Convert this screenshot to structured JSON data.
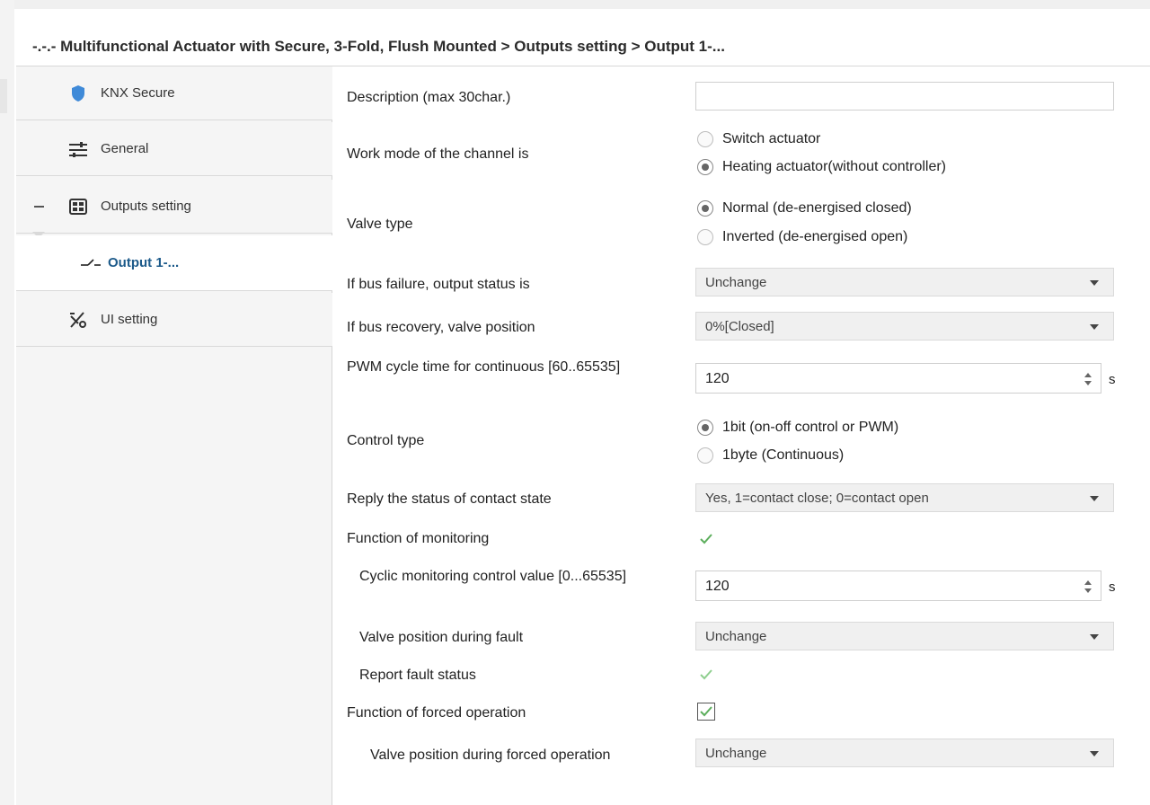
{
  "header": {
    "title": "-.-.- Multifunctional Actuator with Secure, 3-Fold, Flush Mounted > Outputs setting > Output 1-..."
  },
  "sidebar": {
    "items": [
      {
        "label": "KNX Secure",
        "icon": "shield-icon"
      },
      {
        "label": "General",
        "icon": "sliders-icon"
      },
      {
        "label": "Outputs setting",
        "icon": "grid-panel-icon"
      },
      {
        "label": "Output 1-...",
        "icon": "switch-contact-icon"
      },
      {
        "label": "UI setting",
        "icon": "ui-tools-icon"
      }
    ]
  },
  "form": {
    "description": {
      "label": "Description (max 30char.)",
      "value": ""
    },
    "work_mode": {
      "label": "Work mode of the channel is",
      "options": [
        "Switch actuator",
        "Heating actuator(without controller)"
      ],
      "selected": 1
    },
    "valve_type": {
      "label": "Valve type",
      "options": [
        "Normal (de-energised closed)",
        "Inverted (de-energised open)"
      ],
      "selected": 0
    },
    "bus_failure": {
      "label": "If bus failure, output status is",
      "value": "Unchange"
    },
    "bus_recovery": {
      "label": "If bus recovery, valve position",
      "value": "0%[Closed]"
    },
    "pwm_cycle": {
      "label": "PWM cycle time for continuous [60..65535]",
      "value": "120",
      "unit": "s"
    },
    "control_type": {
      "label": "Control type",
      "options": [
        "1bit (on-off control or PWM)",
        "1byte (Continuous)"
      ],
      "selected": 0
    },
    "reply_status": {
      "label": "Reply the status of contact state",
      "value": "Yes, 1=contact close; 0=contact open"
    },
    "monitoring": {
      "label": "Function of monitoring",
      "checked": true
    },
    "cyclic_monitoring": {
      "label": "Cyclic monitoring control value [0...65535]",
      "value": "120",
      "unit": "s"
    },
    "valve_fault": {
      "label": "Valve position during fault",
      "value": "Unchange"
    },
    "report_fault": {
      "label": "Report fault status",
      "checked": true
    },
    "forced_operation": {
      "label": "Function of forced operation",
      "checked": true
    },
    "valve_forced": {
      "label": "Valve position during forced operation",
      "value": "Unchange"
    }
  },
  "colors": {
    "selected_nav_text": "#1c5a8a",
    "shield_blue": "#3f8ad8",
    "check_green": "#5cae5c"
  }
}
